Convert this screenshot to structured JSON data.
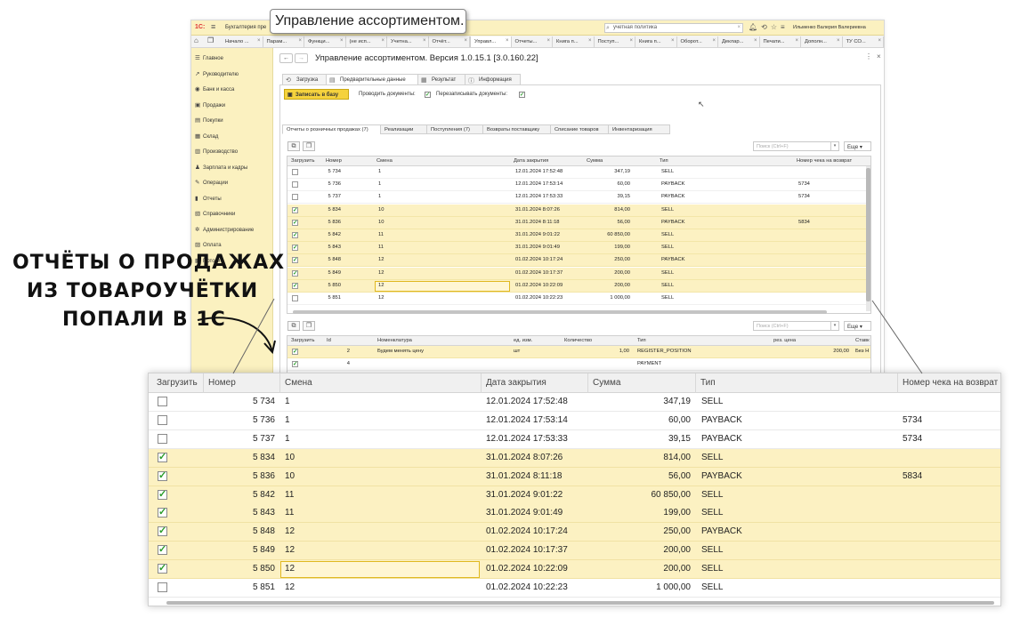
{
  "callout": "Управление ассортиментом.",
  "annotation": {
    "line1": "ОТЧЁТЫ О ПРОДАЖАХ",
    "line2": "ИЗ ТОВАРОУЧЁТКИ",
    "line3": "ПОПАЛИ В 1С"
  },
  "topbar": {
    "app_title": "Бухгалтерия пре",
    "search_value": "учетная политика",
    "user": "Ильменко Валерия Валериевна"
  },
  "window_tabs": [
    {
      "label": "Начало ..."
    },
    {
      "label": "Парам..."
    },
    {
      "label": "Функци..."
    },
    {
      "label": "(не исп..."
    },
    {
      "label": "Учетна..."
    },
    {
      "label": "Отчёт..."
    },
    {
      "label": "Управл..."
    },
    {
      "label": "Отчеты..."
    },
    {
      "label": "Книга п..."
    },
    {
      "label": "Поступ..."
    },
    {
      "label": "Книга п..."
    },
    {
      "label": "Оборот..."
    },
    {
      "label": "Деклар..."
    },
    {
      "label": "Печати..."
    },
    {
      "label": "Дополн..."
    },
    {
      "label": "ТУ СО..."
    }
  ],
  "sidebar": {
    "items": [
      {
        "label": "Главное",
        "icon": "☰"
      },
      {
        "label": "Руководителю",
        "icon": "↗"
      },
      {
        "label": "Банк и касса",
        "icon": "◉"
      },
      {
        "label": "Продажи",
        "icon": "▣"
      },
      {
        "label": "Покупки",
        "icon": "▤"
      },
      {
        "label": "Склад",
        "icon": "▦"
      },
      {
        "label": "Производство",
        "icon": "▥"
      },
      {
        "label": "Зарплата и кадры",
        "icon": "♟"
      },
      {
        "label": "Операции",
        "icon": "✎"
      },
      {
        "label": "Отчеты",
        "icon": "▮"
      },
      {
        "label": "Справочники",
        "icon": "▧"
      },
      {
        "label": "Администрирование",
        "icon": "✲"
      },
      {
        "label": "Оплата",
        "icon": "▨"
      },
      {
        "label": "Потоки",
        "icon": "▩"
      }
    ]
  },
  "form": {
    "title": "Управление ассортиментом. Версия 1.0.15.1 [3.0.160.22]",
    "tabs": [
      {
        "label": "Загрузка",
        "icon": "⟲"
      },
      {
        "label": "Предварительные данные",
        "icon": "▤"
      },
      {
        "label": "Результат",
        "icon": "▦"
      },
      {
        "label": "Информация",
        "icon": "ⓘ"
      }
    ],
    "save_label": "Записать в базу",
    "post_docs_label": "Проводить документы:",
    "overwrite_docs_label": "Перезаписывать документы:",
    "subtabs": [
      {
        "label": "Отчеты о розничных продажах (7)"
      },
      {
        "label": "Реализации"
      },
      {
        "label": "Поступления (7)"
      },
      {
        "label": "Возвраты поставщику"
      },
      {
        "label": "Списание товаров"
      },
      {
        "label": "Инвентаризация"
      }
    ],
    "search_placeholder": "Поиск (Ctrl+F)",
    "more_label": "Еще ▾"
  },
  "reports_table": {
    "columns": [
      "Загрузить",
      "Номер",
      "Смена",
      "Дата закрытия",
      "Сумма",
      "Тип",
      "Номер чека на возврат"
    ],
    "rows": [
      {
        "checked": false,
        "number": "5 734",
        "shift": "1",
        "date": "12.01.2024 17:52:48",
        "sum": "347,19",
        "type": "SELL",
        "return_check": ""
      },
      {
        "checked": false,
        "number": "5 736",
        "shift": "1",
        "date": "12.01.2024 17:53:14",
        "sum": "60,00",
        "type": "PAYBACK",
        "return_check": "5734"
      },
      {
        "checked": false,
        "number": "5 737",
        "shift": "1",
        "date": "12.01.2024 17:53:33",
        "sum": "39,15",
        "type": "PAYBACK",
        "return_check": "5734"
      },
      {
        "checked": true,
        "number": "5 834",
        "shift": "10",
        "date": "31.01.2024 8:07:26",
        "sum": "814,00",
        "type": "SELL",
        "return_check": ""
      },
      {
        "checked": true,
        "number": "5 836",
        "shift": "10",
        "date": "31.01.2024 8:11:18",
        "sum": "56,00",
        "type": "PAYBACK",
        "return_check": "5834"
      },
      {
        "checked": true,
        "number": "5 842",
        "shift": "11",
        "date": "31.01.2024 9:01:22",
        "sum": "60 850,00",
        "type": "SELL",
        "return_check": ""
      },
      {
        "checked": true,
        "number": "5 843",
        "shift": "11",
        "date": "31.01.2024 9:01:49",
        "sum": "199,00",
        "type": "SELL",
        "return_check": ""
      },
      {
        "checked": true,
        "number": "5 848",
        "shift": "12",
        "date": "01.02.2024 10:17:24",
        "sum": "250,00",
        "type": "PAYBACK",
        "return_check": ""
      },
      {
        "checked": true,
        "number": "5 849",
        "shift": "12",
        "date": "01.02.2024 10:17:37",
        "sum": "200,00",
        "type": "SELL",
        "return_check": ""
      },
      {
        "checked": true,
        "number": "5 850",
        "shift": "12",
        "date": "01.02.2024 10:22:09",
        "sum": "200,00",
        "type": "SELL",
        "return_check": ""
      },
      {
        "checked": false,
        "number": "5 851",
        "shift": "12",
        "date": "01.02.2024 10:22:23",
        "sum": "1 000,00",
        "type": "SELL",
        "return_check": ""
      }
    ]
  },
  "positions_table": {
    "columns": [
      "Загрузить",
      "Id",
      "Номенклатура",
      "ед. изм.",
      "Количество",
      "Тип",
      "рез. цена",
      "Ставк"
    ],
    "rows": [
      {
        "checked": true,
        "id": "2",
        "nomenclature": "Будем менять цену",
        "unit": "шт",
        "qty": "1,00",
        "type": "REGISTER_POSITION",
        "price": "200,00",
        "rate": "Без Н"
      },
      {
        "checked": true,
        "id": "4",
        "nomenclature": "",
        "unit": "",
        "qty": "",
        "type": "PAYMENT",
        "price": "",
        "rate": ""
      }
    ]
  }
}
